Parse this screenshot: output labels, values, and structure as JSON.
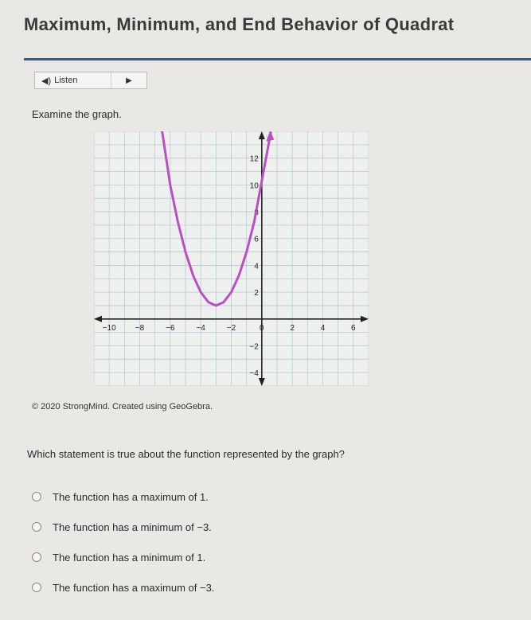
{
  "page": {
    "title": "Maximum, Minimum, and End Behavior of Quadrat",
    "listen_label": "Listen",
    "prompt": "Examine the graph.",
    "credit": "© 2020 StrongMind. Created using GeoGebra.",
    "question": "Which statement is true about the function represented by the graph?",
    "options": [
      "The function has a maximum of 1.",
      "The function has a minimum of −3.",
      "The function has a minimum of 1.",
      "The function has a maximum of −3."
    ],
    "icons": {
      "speaker": "speaker-icon",
      "play": "play-icon"
    },
    "colors": {
      "accent_rule": "#2b5f9a",
      "curve": "#b84fc4",
      "grid": "#b9c9d6"
    }
  },
  "chart_data": {
    "type": "line",
    "function": "y = x^2 + 6x + 10",
    "vertex": [
      -3,
      1
    ],
    "x_ticks": [
      -10,
      -8,
      -6,
      -4,
      -2,
      0,
      2,
      4,
      6
    ],
    "y_ticks": [
      -4,
      -2,
      0,
      2,
      4,
      6,
      8,
      10,
      12
    ],
    "x_tick_labels": [
      "−10",
      "−8",
      "−6",
      "−4",
      "−2",
      "0",
      "2",
      "4",
      "6"
    ],
    "y_tick_labels": [
      "−4",
      "−2",
      "",
      "2",
      "4",
      "6",
      "8",
      "10",
      "12"
    ],
    "xlim": [
      -11,
      7
    ],
    "ylim": [
      -5,
      14
    ],
    "grid": true,
    "series": [
      {
        "x": [
          -7,
          -6.5,
          -6,
          -5.5,
          -5,
          -4.5,
          -4,
          -3.5,
          -3,
          -2.5,
          -2,
          -1.5,
          -1,
          -0.5,
          0.6
        ],
        "y": [
          17,
          13.75,
          10,
          7.25,
          5,
          3.25,
          2,
          1.25,
          1,
          1.25,
          2,
          3.25,
          5,
          7.25,
          13.96
        ]
      }
    ]
  }
}
